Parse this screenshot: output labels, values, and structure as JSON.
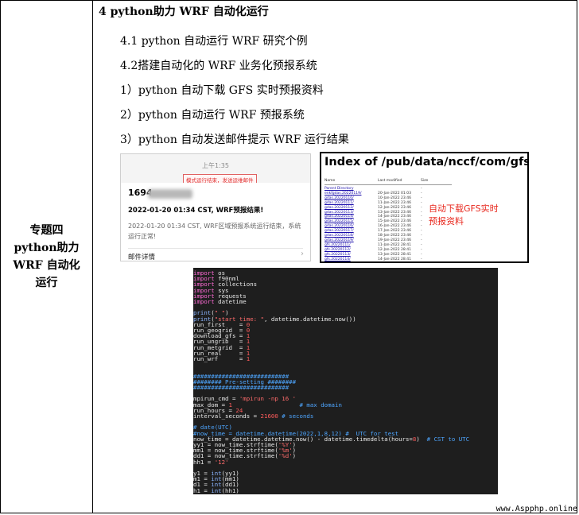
{
  "topic": "专题四 python助力 WRF 自动化运行",
  "heading": "4 python助力 WRF 自动化运行",
  "subitems": [
    "4.1 python 自动运行 WRF 研究个例",
    "4.2搭建自动化的 WRF 业务化预报系统",
    "1）python 自动下载 GFS 实时预报资料",
    "2）python 自动运行 WRF 预报系统",
    "3）python 自动发送邮件提示 WRF 运行结果"
  ],
  "email": {
    "time": "上午1:35",
    "note": "模式运行结束，发送运维邮件",
    "sender": "1694",
    "subject": "2022-01-20 01:34 CST, WRF预报结果!",
    "body": "2022-01-20 01:34 CST, WRF区域预报系统运行结束，系统运行正常!",
    "detail": "邮件详情",
    "chevron": "›"
  },
  "index": {
    "title": "Index of /pub/data/nccf/com/gfs/prod",
    "columns": [
      "Name",
      "Last modified",
      "Size"
    ],
    "rows": [
      {
        "name": "Parent Directory",
        "date": "",
        "size": "-"
      },
      {
        "name": "enkfgdas.20220119/",
        "date": "20-Jan-2022 01:03",
        "size": "-"
      },
      {
        "name": "gdas.20220110/",
        "date": "10-Jan-2022 23:46",
        "size": "-"
      },
      {
        "name": "gdas.20220111/",
        "date": "11-Jan-2022 23:46",
        "size": "-"
      },
      {
        "name": "gdas.20220112/",
        "date": "12-Jan-2022 23:46",
        "size": "-"
      },
      {
        "name": "gdas.20220113/",
        "date": "13-Jan-2022 23:46",
        "size": "-"
      },
      {
        "name": "gdas.20220114/",
        "date": "14-Jan-2022 23:46",
        "size": "-"
      },
      {
        "name": "gdas.20220115/",
        "date": "15-Jan-2022 23:46",
        "size": "-"
      },
      {
        "name": "gdas.20220116/",
        "date": "16-Jan-2022 23:46",
        "size": "-"
      },
      {
        "name": "gdas.20220117/",
        "date": "17-Jan-2022 23:46",
        "size": "-"
      },
      {
        "name": "gdas.20220118/",
        "date": "18-Jan-2022 23:46",
        "size": "-"
      },
      {
        "name": "gdas.20220119/",
        "date": "19-Jan-2022 23:46",
        "size": "-"
      },
      {
        "name": "gfs.20220111/",
        "date": "11-Jan-2022 28:41",
        "size": "-"
      },
      {
        "name": "gfs.20220112/",
        "date": "12-Jan-2022 28:41",
        "size": "-"
      },
      {
        "name": "gfs.20220113/",
        "date": "13-Jan-2022 28:41",
        "size": "-"
      },
      {
        "name": "gfs.20220114/",
        "date": "14-Jan-2022 28:41",
        "size": "-"
      }
    ],
    "callout": "自动下载GFS实时预报资料"
  },
  "code_lines": [
    [
      [
        "kw",
        "import"
      ],
      [
        "pl",
        " os"
      ]
    ],
    [
      [
        "kw",
        "import"
      ],
      [
        "pl",
        " f90nml"
      ]
    ],
    [
      [
        "kw",
        "import"
      ],
      [
        "pl",
        " collections"
      ]
    ],
    [
      [
        "kw",
        "import"
      ],
      [
        "pl",
        " sys"
      ]
    ],
    [
      [
        "kw",
        "import"
      ],
      [
        "pl",
        " requests"
      ]
    ],
    [
      [
        "kw",
        "import"
      ],
      [
        "pl",
        " datetime"
      ]
    ],
    [],
    [
      [
        "fn",
        "print"
      ],
      [
        "pl",
        "("
      ],
      [
        "str",
        "\" \""
      ],
      [
        "pl",
        ")"
      ]
    ],
    [
      [
        "fn",
        "print"
      ],
      [
        "pl",
        "("
      ],
      [
        "str",
        "\"start time: \""
      ],
      [
        "pl",
        ", datetime.datetime.now())"
      ]
    ],
    [
      [
        "pl",
        "run_first    = "
      ],
      [
        "num",
        "0"
      ]
    ],
    [
      [
        "pl",
        "run_geogrid  = "
      ],
      [
        "num",
        "0"
      ]
    ],
    [
      [
        "pl",
        "download_gfs = "
      ],
      [
        "num",
        "1"
      ]
    ],
    [
      [
        "pl",
        "run_ungrib   = "
      ],
      [
        "num",
        "1"
      ]
    ],
    [
      [
        "pl",
        "run_metgrid  = "
      ],
      [
        "num",
        "1"
      ]
    ],
    [
      [
        "pl",
        "run_real     = "
      ],
      [
        "num",
        "1"
      ]
    ],
    [
      [
        "pl",
        "run_wrf      = "
      ],
      [
        "num",
        "1"
      ]
    ],
    [],
    [],
    [
      [
        "cm",
        "###########################"
      ]
    ],
    [
      [
        "cm",
        "######## Pre-setting ########"
      ]
    ],
    [
      [
        "cm",
        "###########################"
      ]
    ],
    [],
    [
      [
        "pl",
        "mpirun_cmd = "
      ],
      [
        "str",
        "'mpirun -np 16 '"
      ]
    ],
    [
      [
        "pl",
        "max_dom = "
      ],
      [
        "num",
        "1"
      ],
      [
        "cm",
        "                   # max domain"
      ]
    ],
    [
      [
        "pl",
        "run_hours = "
      ],
      [
        "num",
        "24"
      ]
    ],
    [
      [
        "pl",
        "interval_seconds = "
      ],
      [
        "num",
        "21600"
      ],
      [
        "cm",
        " # seconds"
      ]
    ],
    [],
    [
      [
        "cm",
        "# date(UTC)"
      ]
    ],
    [
      [
        "cm",
        "#now_time = datetime.datetime(2022,1,8,12) #  UTC for test"
      ]
    ],
    [
      [
        "pl",
        "now_time = datetime.datetime.now() - datetime.timedelta(hours="
      ],
      [
        "num",
        "8"
      ],
      [
        "pl",
        ")"
      ],
      [
        "cm",
        "  # CST to UTC"
      ]
    ],
    [
      [
        "pl",
        "yy1 = now_time.strftime("
      ],
      [
        "str",
        "'%Y'"
      ],
      [
        "pl",
        ")"
      ]
    ],
    [
      [
        "pl",
        "mm1 = now_time.strftime("
      ],
      [
        "str",
        "'%m'"
      ],
      [
        "pl",
        ")"
      ]
    ],
    [
      [
        "pl",
        "dd1 = now_time.strftime("
      ],
      [
        "str",
        "'%d'"
      ],
      [
        "pl",
        ")"
      ]
    ],
    [
      [
        "pl",
        "hh1 = "
      ],
      [
        "str",
        "'12'"
      ]
    ],
    [],
    [
      [
        "pl",
        "y1 = "
      ],
      [
        "fn",
        "int"
      ],
      [
        "pl",
        "(yy1)"
      ]
    ],
    [
      [
        "pl",
        "m1 = "
      ],
      [
        "fn",
        "int"
      ],
      [
        "pl",
        "(mm1)"
      ]
    ],
    [
      [
        "pl",
        "d1 = "
      ],
      [
        "fn",
        "int"
      ],
      [
        "pl",
        "(dd1)"
      ]
    ],
    [
      [
        "pl",
        "h1 = "
      ],
      [
        "fn",
        "int"
      ],
      [
        "pl",
        "(hh1)"
      ]
    ]
  ],
  "footer": "www.Aspphp.online"
}
